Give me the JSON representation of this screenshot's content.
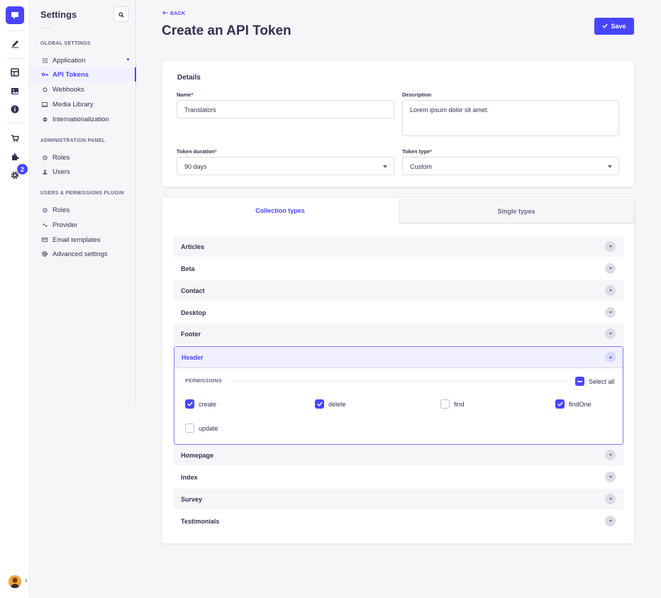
{
  "subnav": {
    "title": "Settings",
    "sections": [
      {
        "heading": "Global Settings",
        "items": [
          {
            "label": "Application",
            "icon": "grid-icon"
          },
          {
            "label": "API Tokens",
            "icon": "key-icon"
          },
          {
            "label": "Webhooks",
            "icon": "webhook-icon"
          },
          {
            "label": "Media Library",
            "icon": "image-icon"
          },
          {
            "label": "Internationalization",
            "icon": "globe-icon"
          }
        ]
      },
      {
        "heading": "Administration Panel",
        "items": [
          {
            "label": "Roles",
            "icon": "roles-icon"
          },
          {
            "label": "Users",
            "icon": "user-icon"
          }
        ]
      },
      {
        "heading": "Users & Permissions Plugin",
        "items": [
          {
            "label": "Roles",
            "icon": "roles-icon"
          },
          {
            "label": "Provider",
            "icon": "provider-icon"
          },
          {
            "label": "Email templates",
            "icon": "email-icon"
          },
          {
            "label": "Advanced settings",
            "icon": "gear-icon"
          }
        ]
      }
    ]
  },
  "rail": {
    "badge": "2",
    "icons": [
      "content-manager-icon",
      "content-type-builder-icon",
      "media-library-icon",
      "info-icon",
      "marketplace-icon",
      "plugins-icon",
      "settings-icon"
    ]
  },
  "header": {
    "back_label": "BACK",
    "title": "Create an API Token",
    "save_label": "Save"
  },
  "details": {
    "title": "Details",
    "name_label": "Name",
    "name_value": "Translators",
    "description_label": "Description",
    "description_value": "Lorem ipsum dolor sit amet.",
    "duration_label": "Token duration",
    "duration_value": "90 days",
    "type_label": "Token type",
    "type_value": "Custom"
  },
  "permissions": {
    "tabs": [
      "Collection types",
      "Single types"
    ],
    "rows_before": [
      "Articles",
      "Beta",
      "Contact",
      "Desktop",
      "Footer"
    ],
    "open": {
      "name": "Header",
      "label": "PERMISSIONS",
      "select_all": "Select all",
      "actions": [
        {
          "label": "create",
          "checked": true
        },
        {
          "label": "delete",
          "checked": true
        },
        {
          "label": "find",
          "checked": false
        },
        {
          "label": "findOne",
          "checked": true
        },
        {
          "label": "update",
          "checked": false
        }
      ]
    },
    "rows_after": [
      "Homepage",
      "Index",
      "Survey",
      "Testimonials"
    ]
  },
  "colors": {
    "primary": "#4945ff",
    "primary_light": "#f0f0ff",
    "danger": "#d02b20",
    "text": "#32324d",
    "muted": "#666687"
  }
}
